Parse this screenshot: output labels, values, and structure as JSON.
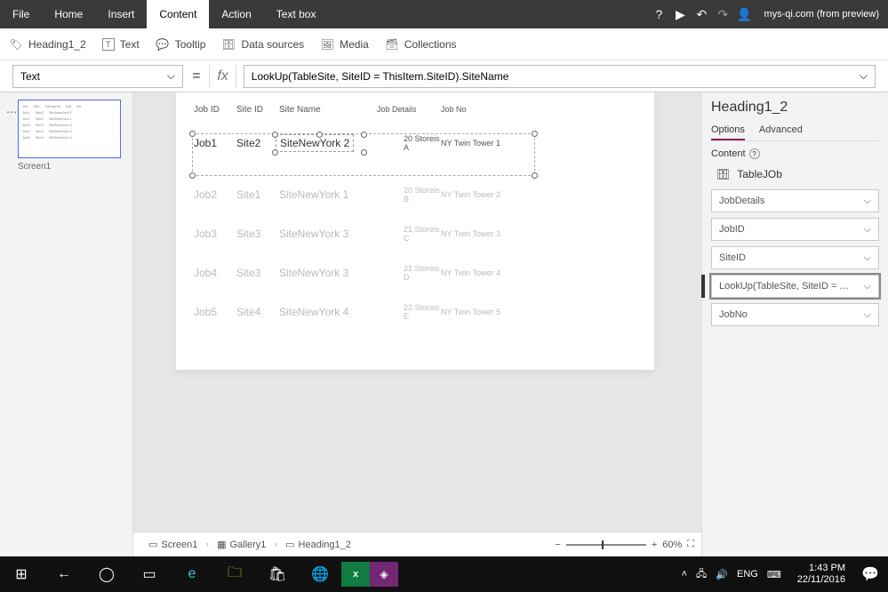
{
  "titlebar": {
    "tabs": [
      "File",
      "Home",
      "Insert",
      "Content",
      "Action",
      "Text box"
    ],
    "active_tab": "Content",
    "user": "mys-qi.com (from preview)"
  },
  "ribbon": {
    "heading": "Heading1_2",
    "text": "Text",
    "tooltip": "Tooltip",
    "data_sources": "Data sources",
    "media": "Media",
    "collections": "Collections"
  },
  "formula": {
    "property": "Text",
    "expression": "LookUp(TableSite, SiteID = ThisItem.SiteID).SiteName"
  },
  "screen_thumb_label": "Screen1",
  "table": {
    "headers": {
      "jobid": "Job ID",
      "siteid": "Site ID",
      "sitename": "Site Name",
      "details": "Job Details",
      "jobno": "Job No"
    },
    "rows": [
      {
        "jobid": "Job1",
        "siteid": "Site2",
        "sitename": "SiteNewYork 2",
        "details": "20 Storeis A",
        "jobno": "NY Twin Tower 1"
      },
      {
        "jobid": "Job2",
        "siteid": "Site1",
        "sitename": "SiteNewYork 1",
        "details": "20 Storeis B",
        "jobno": "NY Twin Tower 2"
      },
      {
        "jobid": "Job3",
        "siteid": "Site3",
        "sitename": "SiteNewYork 3",
        "details": "21 Storeis C",
        "jobno": "NY Twin Tower 3"
      },
      {
        "jobid": "Job4",
        "siteid": "Site3",
        "sitename": "SiteNewYork 3",
        "details": "21 Storeis D",
        "jobno": "NY Twin Tower 4"
      },
      {
        "jobid": "Job5",
        "siteid": "Site4",
        "sitename": "SiteNewYork 4",
        "details": "22 Storeis E",
        "jobno": "NY Twin Tower 5"
      }
    ]
  },
  "right_pane": {
    "title": "Heading1_2",
    "tabs": {
      "options": "Options",
      "advanced": "Advanced"
    },
    "content_label": "Content",
    "table_name": "TableJOb",
    "fields": {
      "jobdetails": "JobDetails",
      "jobid": "JobID",
      "siteid": "SiteID",
      "lookup": "LookUp(TableSite, SiteID = ThisItem.Si...",
      "jobno": "JobNo"
    }
  },
  "breadcrumb": {
    "screen": "Screen1",
    "gallery": "Gallery1",
    "heading": "Heading1_2"
  },
  "zoom": {
    "percent": "60%"
  },
  "taskbar": {
    "lang": "ENG",
    "time": "1:43 PM",
    "date": "22/11/2016"
  }
}
